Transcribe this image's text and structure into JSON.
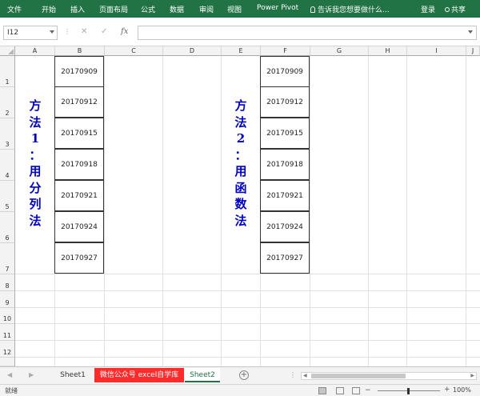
{
  "ribbon": {
    "tabs": [
      "文件",
      "开始",
      "插入",
      "页面布局",
      "公式",
      "数据",
      "审阅",
      "视图",
      "Power Pivot"
    ],
    "tell_me": "告诉我您想要做什么...",
    "login": "登录",
    "share": "共享"
  },
  "formula_bar": {
    "name_box": "I12",
    "cancel_icon": "✕",
    "enter_icon": "✓",
    "fx_label": "fx",
    "formula": ""
  },
  "grid": {
    "columns": [
      "A",
      "B",
      "C",
      "D",
      "E",
      "F",
      "G",
      "H",
      "I",
      "J"
    ],
    "rows": [
      "1",
      "2",
      "3",
      "4",
      "5",
      "6",
      "7",
      "8",
      "9",
      "10",
      "11",
      "12"
    ]
  },
  "table_left": {
    "label_chars": [
      "方",
      "法",
      "1",
      "：",
      "用",
      "分",
      "列",
      "法"
    ],
    "values": [
      "20170909",
      "20170912",
      "20170915",
      "20170918",
      "20170921",
      "20170924",
      "20170927"
    ]
  },
  "table_right": {
    "label_chars": [
      "方",
      "法",
      "2",
      "：",
      "用",
      "函",
      "数",
      "法"
    ],
    "values": [
      "20170909",
      "20170912",
      "20170915",
      "20170918",
      "20170921",
      "20170924",
      "20170927"
    ]
  },
  "sheets": {
    "tabs": [
      "Sheet1",
      "微信公众号 excel自学库",
      "Sheet2"
    ],
    "active": "Sheet2",
    "add_symbol": "+"
  },
  "status": {
    "ready": "就绪",
    "zoom_minus": "−",
    "zoom_plus": "+",
    "zoom": "100%"
  }
}
